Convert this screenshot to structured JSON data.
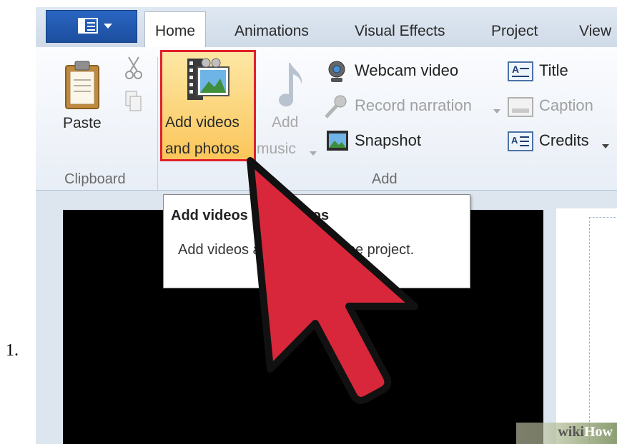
{
  "list_number": "1.",
  "app_menu": {
    "icon": "document-menu-icon"
  },
  "tabs": [
    {
      "label": "Home",
      "active": true
    },
    {
      "label": "Animations"
    },
    {
      "label": "Visual Effects"
    },
    {
      "label": "Project"
    },
    {
      "label": "View"
    }
  ],
  "ribbon": {
    "clipboard": {
      "group_label": "Clipboard",
      "paste_label": "Paste"
    },
    "add": {
      "group_label": "Add",
      "add_videos_label_line1": "Add videos",
      "add_videos_label_line2": "and photos",
      "add_music_label_line1": "Add",
      "add_music_label_line2": "music",
      "webcam_label": "Webcam video",
      "narration_label": "Record narration",
      "snapshot_label": "Snapshot",
      "title_label": "Title",
      "caption_label": "Caption",
      "credits_label": "Credits"
    }
  },
  "tooltip": {
    "title": "Add videos and photos",
    "body": "Add videos and photos to the project."
  },
  "watermark": {
    "part1": "wiki",
    "part2": "How"
  },
  "colors": {
    "highlight_border": "#e0202c",
    "cursor_fill": "#d8273a",
    "app_menu": "#2a66c2"
  }
}
